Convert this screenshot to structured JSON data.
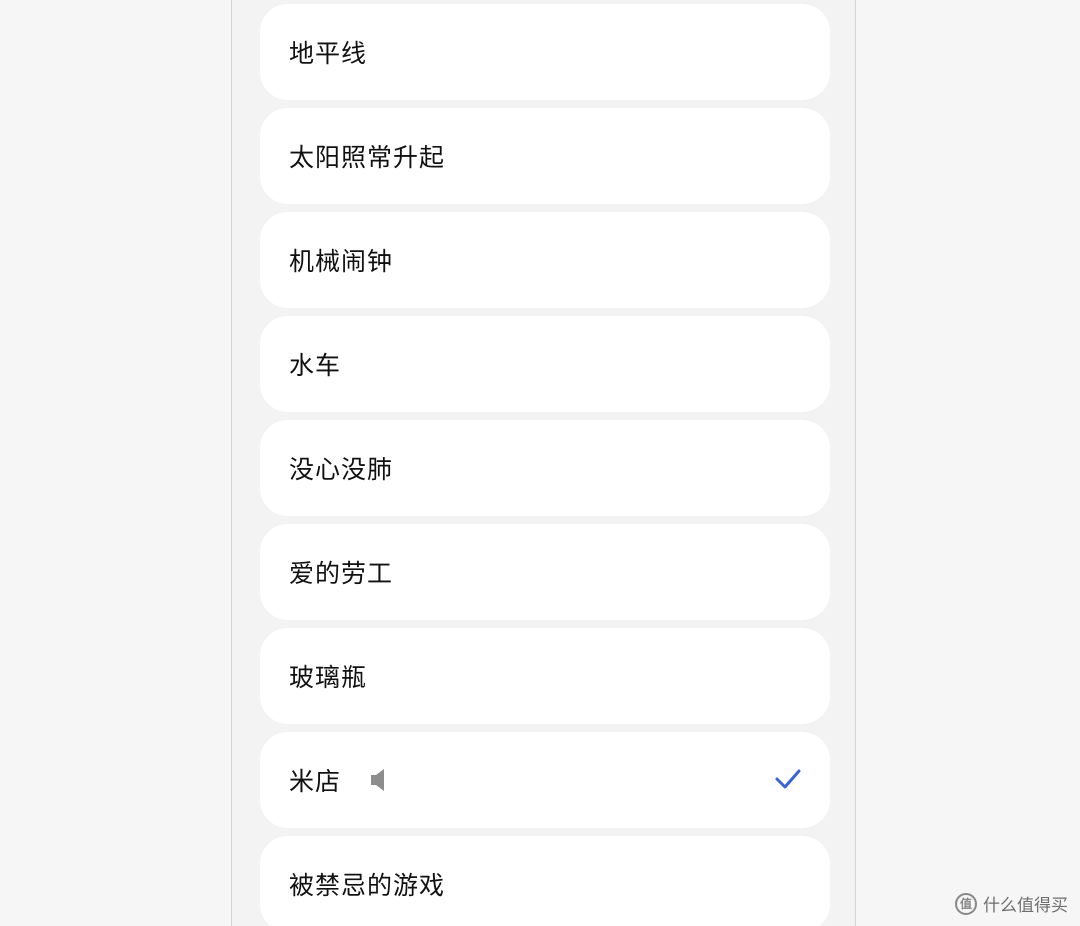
{
  "ringtones": [
    {
      "label": "地平线",
      "selected": false
    },
    {
      "label": "太阳照常升起",
      "selected": false
    },
    {
      "label": "机械闹钟",
      "selected": false
    },
    {
      "label": "水车",
      "selected": false
    },
    {
      "label": "没心没肺",
      "selected": false
    },
    {
      "label": "爱的劳工",
      "selected": false
    },
    {
      "label": "玻璃瓶",
      "selected": false
    },
    {
      "label": "米店",
      "selected": true
    },
    {
      "label": "被禁忌的游戏",
      "selected": false
    }
  ],
  "icons": {
    "speaker": "speaker-icon",
    "check": "checkmark-icon"
  },
  "colors": {
    "accent": "#3a63d8",
    "speaker": "#8d8d8d",
    "background": "#f3f3f3",
    "card": "#ffffff"
  },
  "watermark": {
    "text": "什么值得买",
    "icon_glyph": "值"
  }
}
